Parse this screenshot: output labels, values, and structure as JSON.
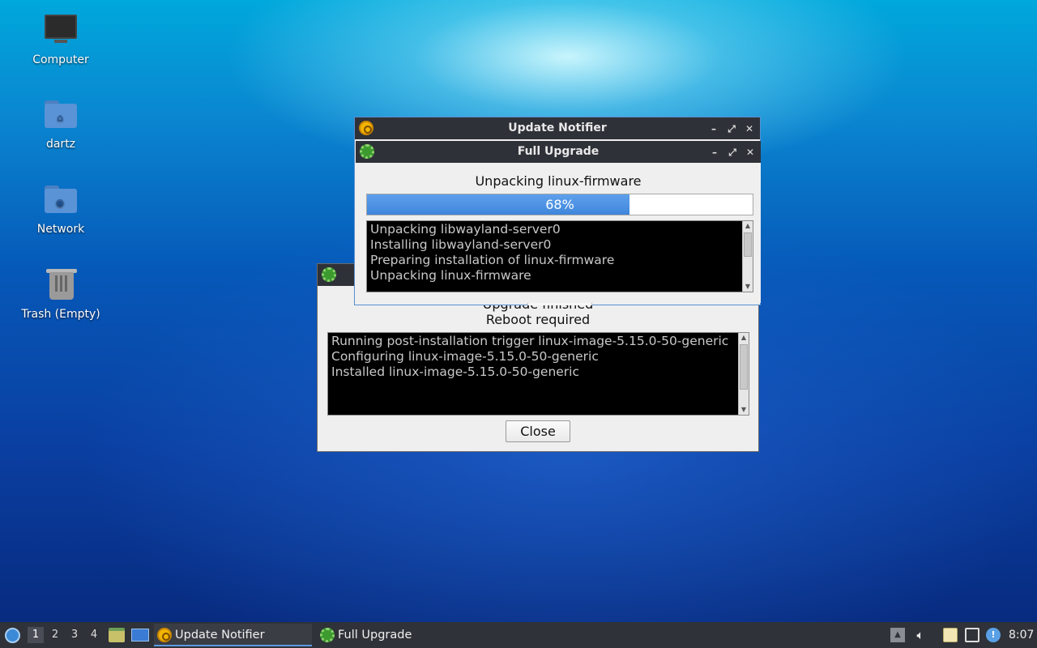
{
  "desktop": {
    "icons": [
      {
        "label": "Computer",
        "icon": "computer-icon"
      },
      {
        "label": "dartz",
        "icon": "home-folder-icon"
      },
      {
        "label": "Network",
        "icon": "network-folder-icon"
      },
      {
        "label": "Trash (Empty)",
        "icon": "trash-icon"
      }
    ]
  },
  "back_window": {
    "status_partial": "Upgrade finished",
    "reboot": "Reboot required",
    "log_lines": [
      "Running post-installation trigger linux-image-5.15.0-50-generic",
      "Configuring linux-image-5.15.0-50-generic",
      "Installed linux-image-5.15.0-50-generic"
    ],
    "close_label": "Close"
  },
  "update_notifier": {
    "title": "Update Notifier"
  },
  "full_upgrade": {
    "title": "Full Upgrade",
    "status": "Unpacking linux-firmware",
    "progress_text": "68%",
    "progress_value": 0.68,
    "log_lines": [
      "Unpacking libwayland-server0",
      "Installing libwayland-server0",
      "Preparing installation of linux-firmware",
      "Unpacking linux-firmware"
    ]
  },
  "taskbar": {
    "workspaces": [
      "1",
      "2",
      "3",
      "4"
    ],
    "active_workspace": "1",
    "tasks": [
      {
        "label": "Update Notifier",
        "icon": "update-notifier-icon",
        "active": true
      },
      {
        "label": "Full Upgrade",
        "icon": "gear-icon",
        "active": false
      }
    ],
    "clock": "8:07"
  },
  "colors": {
    "progress_fill": "#4a90e2",
    "titlebar": "#2f3138",
    "taskbar": "#2f3238"
  }
}
